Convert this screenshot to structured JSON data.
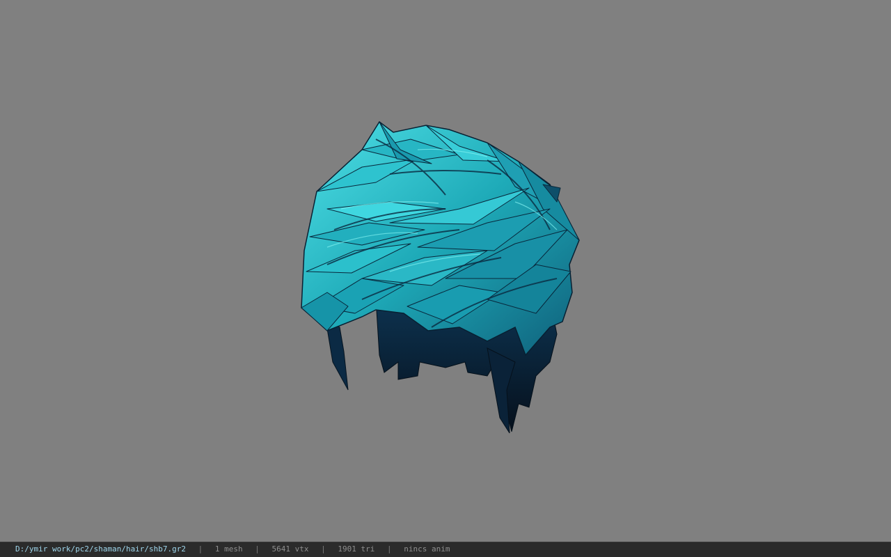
{
  "viewer": {
    "background_color": "#808080",
    "model_colors": {
      "highlight": "#3fd7e0",
      "mid": "#1eaab8",
      "deep": "#137a8c",
      "shadow": "#0b2440",
      "outline": "#061420"
    }
  },
  "status_bar": {
    "file_path": "D:/ymir work/pc2/shaman/hair/shb7.gr2",
    "separator": "|",
    "mesh_count": "1 mesh",
    "vertex_count": "5641 vtx",
    "triangle_count": "1901 tri",
    "anim_status": "nincs anim"
  }
}
